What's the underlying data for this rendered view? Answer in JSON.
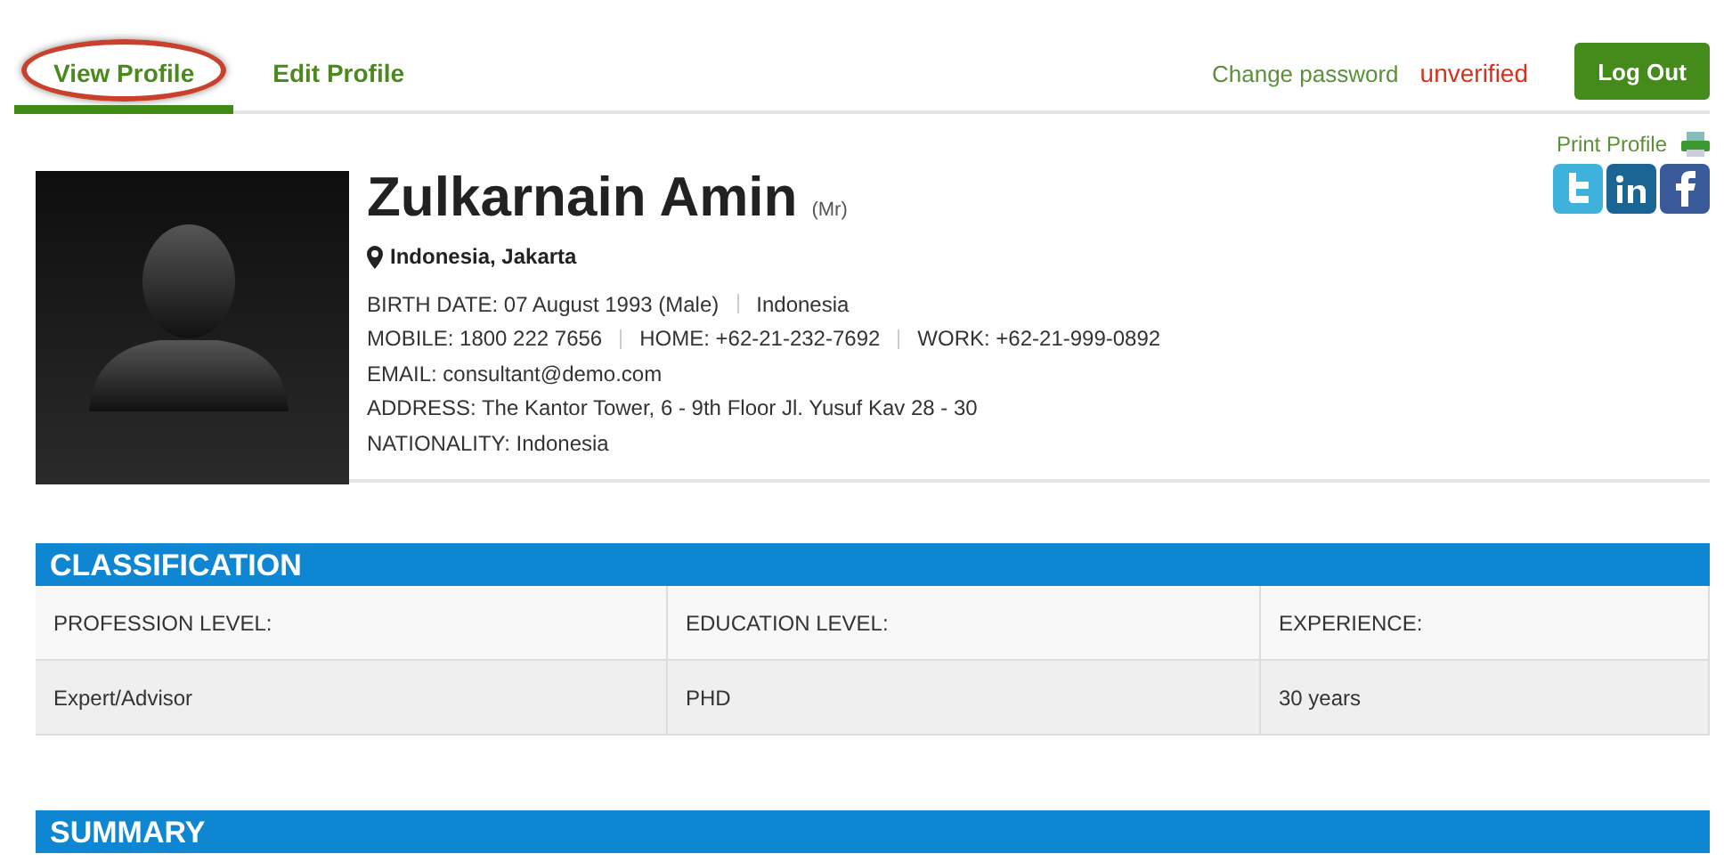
{
  "tabs": [
    {
      "label": "View Profile",
      "selected": true,
      "highlighted": true
    },
    {
      "label": "Edit Profile",
      "selected": false,
      "highlighted": false
    }
  ],
  "account": {
    "change_password": "Change password",
    "status": "unverified",
    "logout": "Log Out"
  },
  "print_profile": "Print Profile",
  "profile": {
    "name": "Zulkarnain Amin",
    "title": "(Mr)",
    "location": "Indonesia, Jakarta",
    "details": [
      [
        "BIRTH DATE: 07 August 1993 (Male)",
        "Indonesia"
      ],
      [
        "MOBILE: 1800 222 7656",
        "HOME: +62-21-232-7692",
        "WORK: +62-21-999-0892"
      ],
      [
        "EMAIL: consultant@demo.com"
      ],
      [
        "ADDRESS: The Kantor Tower, 6 - 9th Floor Jl. Yusuf Kav 28 - 30"
      ],
      [
        "NATIONALITY: Indonesia"
      ]
    ]
  },
  "classification": {
    "title": "CLASSIFICATION",
    "columns": [
      "PROFESSION LEVEL:",
      "EDUCATION LEVEL:",
      "EXPERIENCE:"
    ],
    "values": [
      "Expert/Advisor",
      "PHD",
      "30 years"
    ]
  },
  "summary": {
    "title": "SUMMARY"
  }
}
